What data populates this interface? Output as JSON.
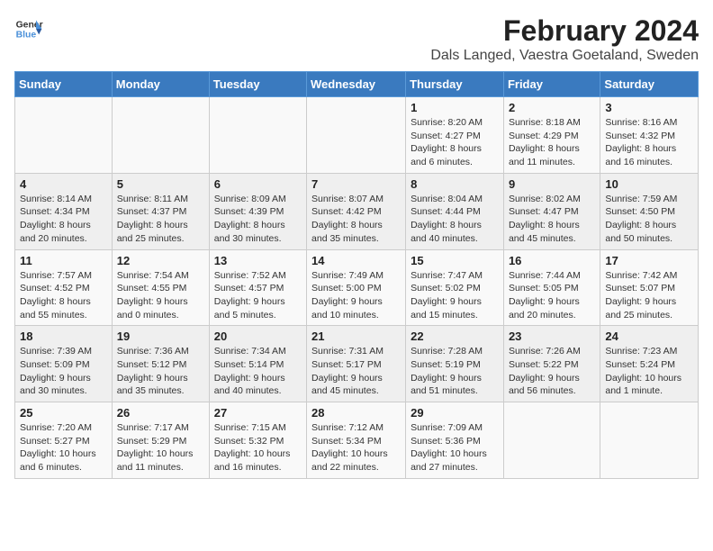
{
  "header": {
    "logo_line1": "General",
    "logo_line2": "Blue",
    "month": "February 2024",
    "location": "Dals Langed, Vaestra Goetaland, Sweden"
  },
  "days_of_week": [
    "Sunday",
    "Monday",
    "Tuesday",
    "Wednesday",
    "Thursday",
    "Friday",
    "Saturday"
  ],
  "weeks": [
    [
      {
        "day": "",
        "info": ""
      },
      {
        "day": "",
        "info": ""
      },
      {
        "day": "",
        "info": ""
      },
      {
        "day": "",
        "info": ""
      },
      {
        "day": "1",
        "info": "Sunrise: 8:20 AM\nSunset: 4:27 PM\nDaylight: 8 hours\nand 6 minutes."
      },
      {
        "day": "2",
        "info": "Sunrise: 8:18 AM\nSunset: 4:29 PM\nDaylight: 8 hours\nand 11 minutes."
      },
      {
        "day": "3",
        "info": "Sunrise: 8:16 AM\nSunset: 4:32 PM\nDaylight: 8 hours\nand 16 minutes."
      }
    ],
    [
      {
        "day": "4",
        "info": "Sunrise: 8:14 AM\nSunset: 4:34 PM\nDaylight: 8 hours\nand 20 minutes."
      },
      {
        "day": "5",
        "info": "Sunrise: 8:11 AM\nSunset: 4:37 PM\nDaylight: 8 hours\nand 25 minutes."
      },
      {
        "day": "6",
        "info": "Sunrise: 8:09 AM\nSunset: 4:39 PM\nDaylight: 8 hours\nand 30 minutes."
      },
      {
        "day": "7",
        "info": "Sunrise: 8:07 AM\nSunset: 4:42 PM\nDaylight: 8 hours\nand 35 minutes."
      },
      {
        "day": "8",
        "info": "Sunrise: 8:04 AM\nSunset: 4:44 PM\nDaylight: 8 hours\nand 40 minutes."
      },
      {
        "day": "9",
        "info": "Sunrise: 8:02 AM\nSunset: 4:47 PM\nDaylight: 8 hours\nand 45 minutes."
      },
      {
        "day": "10",
        "info": "Sunrise: 7:59 AM\nSunset: 4:50 PM\nDaylight: 8 hours\nand 50 minutes."
      }
    ],
    [
      {
        "day": "11",
        "info": "Sunrise: 7:57 AM\nSunset: 4:52 PM\nDaylight: 8 hours\nand 55 minutes."
      },
      {
        "day": "12",
        "info": "Sunrise: 7:54 AM\nSunset: 4:55 PM\nDaylight: 9 hours\nand 0 minutes."
      },
      {
        "day": "13",
        "info": "Sunrise: 7:52 AM\nSunset: 4:57 PM\nDaylight: 9 hours\nand 5 minutes."
      },
      {
        "day": "14",
        "info": "Sunrise: 7:49 AM\nSunset: 5:00 PM\nDaylight: 9 hours\nand 10 minutes."
      },
      {
        "day": "15",
        "info": "Sunrise: 7:47 AM\nSunset: 5:02 PM\nDaylight: 9 hours\nand 15 minutes."
      },
      {
        "day": "16",
        "info": "Sunrise: 7:44 AM\nSunset: 5:05 PM\nDaylight: 9 hours\nand 20 minutes."
      },
      {
        "day": "17",
        "info": "Sunrise: 7:42 AM\nSunset: 5:07 PM\nDaylight: 9 hours\nand 25 minutes."
      }
    ],
    [
      {
        "day": "18",
        "info": "Sunrise: 7:39 AM\nSunset: 5:09 PM\nDaylight: 9 hours\nand 30 minutes."
      },
      {
        "day": "19",
        "info": "Sunrise: 7:36 AM\nSunset: 5:12 PM\nDaylight: 9 hours\nand 35 minutes."
      },
      {
        "day": "20",
        "info": "Sunrise: 7:34 AM\nSunset: 5:14 PM\nDaylight: 9 hours\nand 40 minutes."
      },
      {
        "day": "21",
        "info": "Sunrise: 7:31 AM\nSunset: 5:17 PM\nDaylight: 9 hours\nand 45 minutes."
      },
      {
        "day": "22",
        "info": "Sunrise: 7:28 AM\nSunset: 5:19 PM\nDaylight: 9 hours\nand 51 minutes."
      },
      {
        "day": "23",
        "info": "Sunrise: 7:26 AM\nSunset: 5:22 PM\nDaylight: 9 hours\nand 56 minutes."
      },
      {
        "day": "24",
        "info": "Sunrise: 7:23 AM\nSunset: 5:24 PM\nDaylight: 10 hours\nand 1 minute."
      }
    ],
    [
      {
        "day": "25",
        "info": "Sunrise: 7:20 AM\nSunset: 5:27 PM\nDaylight: 10 hours\nand 6 minutes."
      },
      {
        "day": "26",
        "info": "Sunrise: 7:17 AM\nSunset: 5:29 PM\nDaylight: 10 hours\nand 11 minutes."
      },
      {
        "day": "27",
        "info": "Sunrise: 7:15 AM\nSunset: 5:32 PM\nDaylight: 10 hours\nand 16 minutes."
      },
      {
        "day": "28",
        "info": "Sunrise: 7:12 AM\nSunset: 5:34 PM\nDaylight: 10 hours\nand 22 minutes."
      },
      {
        "day": "29",
        "info": "Sunrise: 7:09 AM\nSunset: 5:36 PM\nDaylight: 10 hours\nand 27 minutes."
      },
      {
        "day": "",
        "info": ""
      },
      {
        "day": "",
        "info": ""
      }
    ]
  ]
}
